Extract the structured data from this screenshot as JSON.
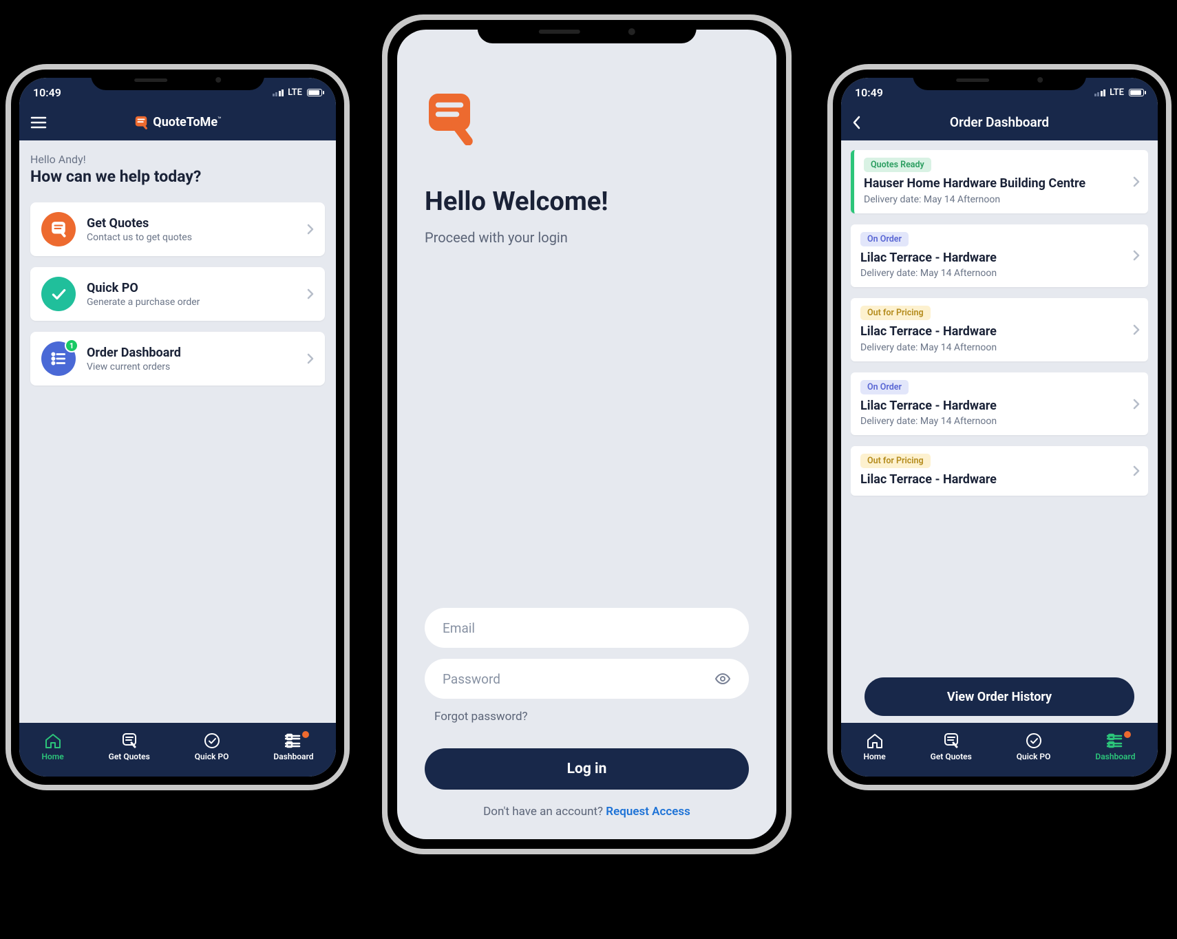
{
  "status": {
    "time": "10:49",
    "network": "LTE"
  },
  "brand": "QuoteToMe",
  "leftPhone": {
    "greeting": "Hello Andy!",
    "headline": "How can we help today?",
    "actions": [
      {
        "title": "Get Quotes",
        "subtitle": "Contact us to get quotes"
      },
      {
        "title": "Quick PO",
        "subtitle": "Generate a purchase order"
      },
      {
        "title": "Order Dashboard",
        "subtitle": "View current orders",
        "badge": "1"
      }
    ]
  },
  "centerPhone": {
    "title": "Hello Welcome!",
    "subtitle": "Proceed with your login",
    "emailPlaceholder": "Email",
    "passwordPlaceholder": "Password",
    "forgot": "Forgot password?",
    "loginBtn": "Log in",
    "noAccount": "Don't have an account? ",
    "requestAccess": "Request Access"
  },
  "rightPhone": {
    "header": "Order Dashboard",
    "historyBtn": "View Order History",
    "orders": [
      {
        "status": "Quotes Ready",
        "pill": "green",
        "accent": true,
        "title": "Hauser Home Hardware Building Centre",
        "delivery": "Delivery date: May 14 Afternoon"
      },
      {
        "status": "On Order",
        "pill": "blue",
        "accent": false,
        "title": "Lilac Terrace - Hardware",
        "delivery": "Delivery date: May 14 Afternoon"
      },
      {
        "status": "Out for Pricing",
        "pill": "yellow",
        "accent": false,
        "title": "Lilac Terrace - Hardware",
        "delivery": "Delivery date: May 14 Afternoon"
      },
      {
        "status": "On Order",
        "pill": "blue",
        "accent": false,
        "title": "Lilac Terrace - Hardware",
        "delivery": "Delivery date: May 14 Afternoon"
      },
      {
        "status": "Out for Pricing",
        "pill": "yellow",
        "accent": false,
        "title": "Lilac Terrace - Hardware",
        "delivery": ""
      }
    ]
  },
  "bottomNav": {
    "home": "Home",
    "quotes": "Get Quotes",
    "quickpo": "Quick PO",
    "dashboard": "Dashboard"
  }
}
